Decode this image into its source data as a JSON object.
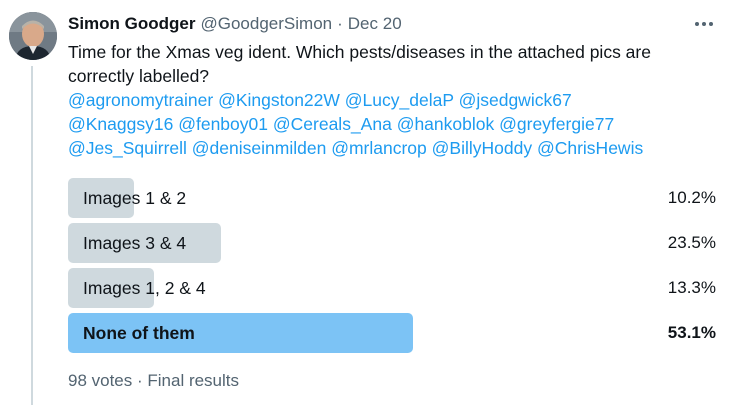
{
  "tweet": {
    "author": {
      "display_name": "Simon Goodger",
      "handle": "@GoodgerSimon",
      "separator": "·",
      "date": "Dec 20"
    },
    "more_icon": "more-horizontal-icon",
    "text_line_1": "Time for the Xmas veg ident. Which pests/diseases in the attached pics are",
    "text_line_2": "correctly labelled?",
    "mentions": [
      [
        "@agronomytrainer",
        "@Kingston22W",
        "@Lucy_delaP",
        "@jsedgwick67"
      ],
      [
        "@Knaggsy16",
        "@fenboy01",
        "@Cereals_Ana",
        "@hankoblok",
        "@greyfergie77"
      ],
      [
        "@Jes_Squirrell",
        "@deniseinmilden",
        "@mrlancrop",
        "@BillyHoddy",
        "@ChrisHewis"
      ]
    ]
  },
  "poll": {
    "options": [
      {
        "label": "Images 1 & 2",
        "percent_text": "10.2%",
        "percent": 10.2,
        "winner": false
      },
      {
        "label": "Images 3 & 4",
        "percent_text": "23.5%",
        "percent": 23.5,
        "winner": false
      },
      {
        "label": "Images 1, 2 & 4",
        "percent_text": "13.3%",
        "percent": 13.3,
        "winner": false
      },
      {
        "label": "None of them",
        "percent_text": "53.1%",
        "percent": 53.1,
        "winner": true
      }
    ],
    "footer": "98 votes · Final results"
  },
  "colors": {
    "accent": "#1d9bf0",
    "bar": "#cfd9de",
    "bar_winner": "#7cc3f5",
    "secondary_text": "#536471"
  }
}
